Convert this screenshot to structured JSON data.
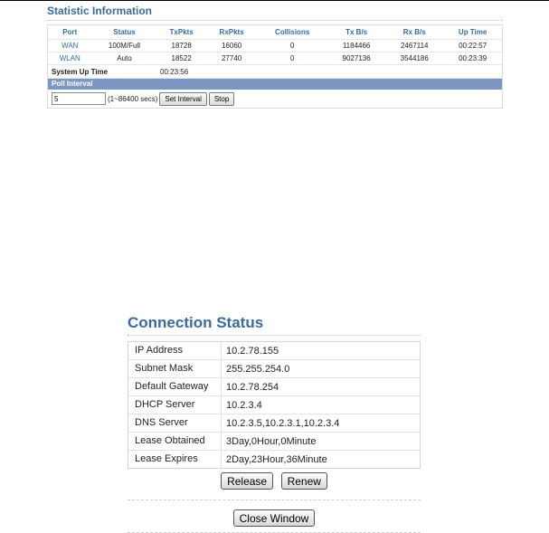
{
  "stats": {
    "title": "Statistic Information",
    "columns": [
      "Port",
      "Status",
      "TxPkts",
      "RxPkts",
      "Collisions",
      "Tx B/s",
      "Rx B/s",
      "Up Time"
    ],
    "rows": [
      [
        "WAN",
        "100M/Full",
        "18728",
        "16060",
        "0",
        "1184466",
        "2467114",
        "00:22:57"
      ],
      [
        "WLAN",
        "Auto",
        "18522",
        "27740",
        "0",
        "9027136",
        "3544186",
        "00:23:39"
      ]
    ],
    "system_uptime_label": "System Up Time",
    "system_uptime_value": "00:23:56",
    "poll_interval_label": "Poll Interval",
    "poll_value": "5",
    "poll_range": "(1~86400 secs)",
    "set_interval_label": "Set Interval",
    "stop_label": "Stop"
  },
  "connection": {
    "title": "Connection Status",
    "fields": [
      {
        "label": "IP Address",
        "value": "10.2.78.155"
      },
      {
        "label": "Subnet Mask",
        "value": "255.255.254.0"
      },
      {
        "label": "Default Gateway",
        "value": "10.2.78.254"
      },
      {
        "label": "DHCP Server",
        "value": "10.2.3.4"
      },
      {
        "label": "DNS Server",
        "value": "10.2.3.5,10.2.3.1,10.2.3.4"
      },
      {
        "label": "Lease Obtained",
        "value": "3Day,0Hour,0Minute"
      },
      {
        "label": "Lease Expires",
        "value": "2Day,23Hour,36Minute"
      }
    ],
    "release_label": "Release",
    "renew_label": "Renew",
    "close_label": "Close Window"
  }
}
